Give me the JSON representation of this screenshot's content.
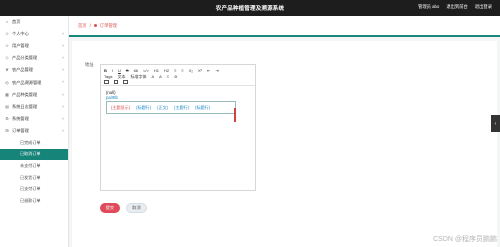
{
  "header": {
    "app_title": "农产品种植管理及溯源系统",
    "user_label": "管理员 abo",
    "exit_to_frontend": "退出到前台",
    "logout": "退出登录"
  },
  "sidebar": {
    "items": [
      {
        "label": "首页",
        "icon": "home-icon"
      },
      {
        "label": "个人中心",
        "icon": "user-icon"
      },
      {
        "label": "用户管理",
        "icon": "users-icon"
      },
      {
        "label": "产品分类管理",
        "icon": "tag-icon"
      },
      {
        "label": "农产品管理",
        "icon": "leaf-icon"
      },
      {
        "label": "农产品溯源管理",
        "icon": "trace-icon"
      },
      {
        "label": "产品种类管理",
        "icon": "grid-icon"
      },
      {
        "label": "系统日志管理",
        "icon": "log-icon"
      },
      {
        "label": "系统管理",
        "icon": "gear-icon"
      },
      {
        "label": "订单管理",
        "icon": "cart-icon"
      }
    ],
    "sub_items": [
      {
        "label": "已完成订单",
        "active": false
      },
      {
        "label": "已取消订单",
        "active": true
      },
      {
        "label": "未支付订单",
        "active": false
      },
      {
        "label": "已发货订单",
        "active": false
      },
      {
        "label": "已支付订单",
        "active": false
      },
      {
        "label": "已退款订单",
        "active": false
      }
    ]
  },
  "breadcrumb": {
    "home": "首页",
    "separator": "/",
    "current": "订单管理"
  },
  "form": {
    "field_label": "地址",
    "editor": {
      "toolbar_row1": [
        "B",
        "I",
        "U",
        "S",
        "66",
        "</>",
        "H1",
        "H2",
        "≡",
        "≡",
        "X₂",
        "X²",
        "⇤",
        "⇥"
      ],
      "toolbar_row2": [
        "Tags",
        "文本",
        "标准字体",
        "A",
        "A",
        "≡",
        "⊘"
      ],
      "toolbar_row3": [
        "link-icon",
        "image-icon",
        "video-icon"
      ],
      "content_line1": "(null)",
      "content_line2": "pa/9tb",
      "doc_items": [
        "(主题显示)",
        "(标题行)",
        "(正文)",
        "(主题行)",
        "(标题行)"
      ]
    },
    "submit_label": "提交",
    "cancel_label": "取消"
  },
  "side_tab": {
    "icon": "chevron-left-icon",
    "glyph": "‹"
  },
  "watermark": "CSDN @程序员鹏鹏"
}
